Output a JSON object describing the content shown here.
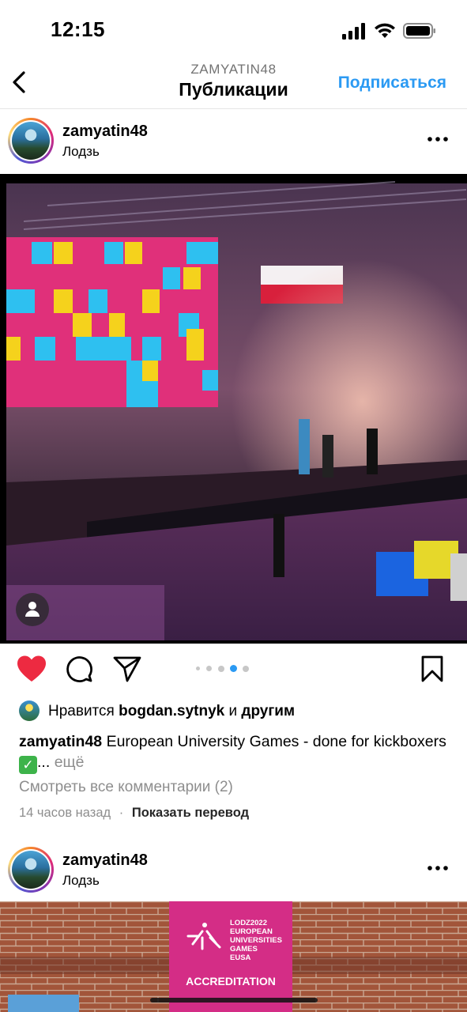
{
  "status_bar": {
    "time": "12:15"
  },
  "header": {
    "username": "ZAMYATIN48",
    "title": "Публикации",
    "follow_label": "Подписаться"
  },
  "posts": [
    {
      "username": "zamyatin48",
      "location": "Лодзь",
      "likes": {
        "prefix": "Нравится",
        "user": "bogdan.sytnyk",
        "and": "и",
        "others": "другим"
      },
      "caption": {
        "username": "zamyatin48",
        "text": "European University Games - done for kickboxers",
        "emoji": "✅",
        "ellipsis": "...",
        "more": "ещё"
      },
      "comments_link": "Смотреть все комментарии (2)",
      "time_ago": "14 часов назад",
      "separator": "·",
      "translate_label": "Показать перевод",
      "carousel": {
        "count": 5,
        "active_index": 3
      }
    },
    {
      "username": "zamyatin48",
      "location": "Лодзь",
      "banner": {
        "line1": "LODZ2022",
        "line2": "EUROPEAN",
        "line3": "UNIVERSITIES",
        "line4": "GAMES",
        "line5": "EUSA",
        "label": "ACCREDITATION"
      }
    }
  ],
  "colors": {
    "accent": "#2b9af3",
    "like": "#ed2a41",
    "banner": "#d42d86"
  },
  "icons": [
    "back-chevron-icon",
    "signal-icon",
    "wifi-icon",
    "battery-icon",
    "more-icon",
    "heart-icon",
    "comment-icon",
    "share-icon",
    "bookmark-icon",
    "user-tag-icon"
  ]
}
